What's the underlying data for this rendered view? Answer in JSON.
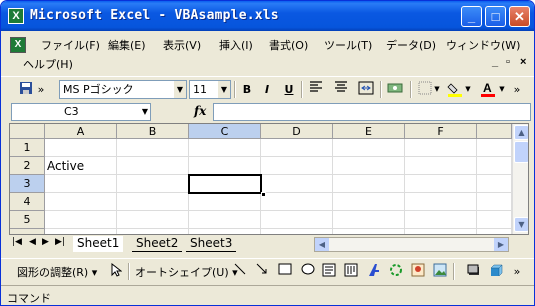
{
  "window": {
    "title": "Microsoft Excel - VBAsample.xls",
    "app_icon": "excel-icon",
    "controls": {
      "minimize": "_",
      "maximize": "□",
      "close": "✕"
    }
  },
  "menu": {
    "items": [
      "ファイル(F)",
      "編集(E)",
      "表示(V)",
      "挿入(I)",
      "書式(O)",
      "ツール(T)",
      "データ(D)",
      "ウィンドウ(W)"
    ],
    "help": "ヘルプ(H)",
    "doc_controls": {
      "minimize": "_",
      "restore": "ð",
      "close": "×"
    }
  },
  "toolbar": {
    "font_name": "MS Pゴシック",
    "font_size": "11",
    "bold": "B",
    "italic": "I",
    "underline": "U",
    "chevron": "»"
  },
  "formula_bar": {
    "name_box": "C3",
    "fx": "fx",
    "content": ""
  },
  "grid": {
    "columns": [
      "A",
      "B",
      "C",
      "D",
      "E",
      "F"
    ],
    "rows": [
      "1",
      "2",
      "3",
      "4",
      "5"
    ],
    "active_column": "C",
    "active_row": "3",
    "cells": {
      "A2": "Active"
    }
  },
  "sheets": {
    "tabs": [
      "Sheet1",
      "Sheet2",
      "Sheet3"
    ],
    "active": "Sheet1"
  },
  "drawing": {
    "draw_menu": "図形の調整(R)",
    "autoshape_menu": "オートシェイプ(U)"
  },
  "status": {
    "text": "コマンド"
  },
  "colors": {
    "title_bar": "#0a58e2",
    "active_header": "#bcd0ee",
    "highlight_fill": "#ffff00",
    "font_color": "#ff0000",
    "excel_green": "#1e7b37"
  }
}
